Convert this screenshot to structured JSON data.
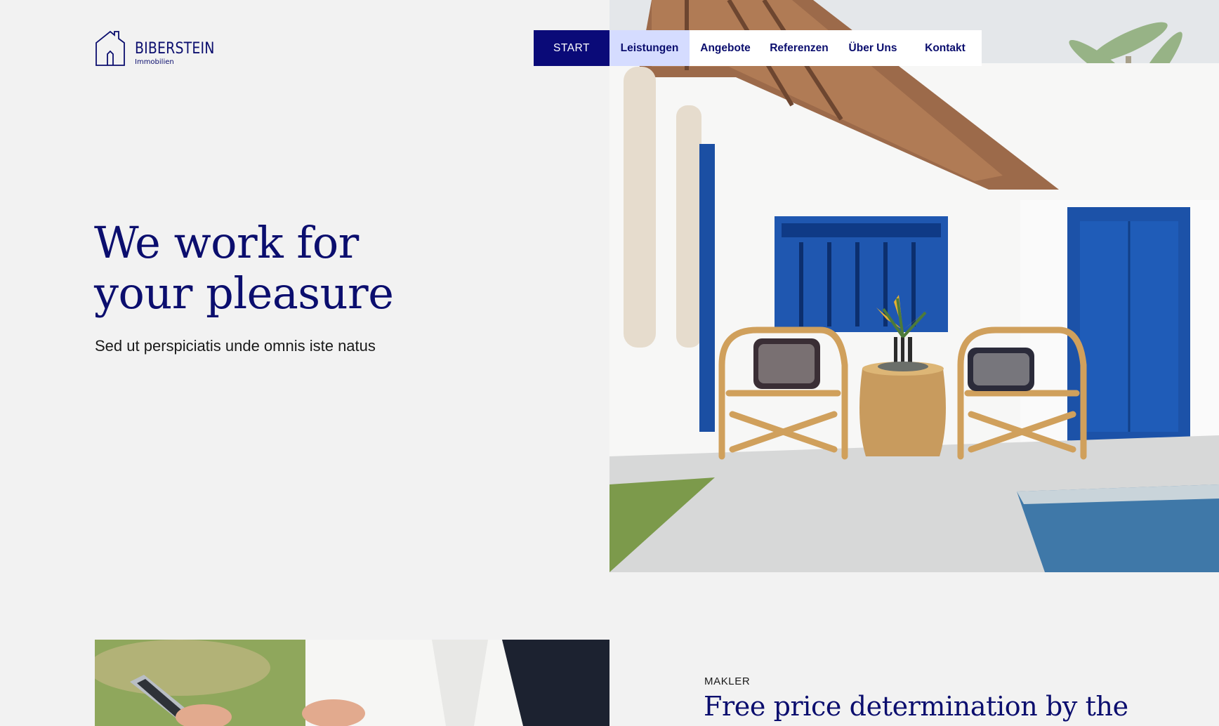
{
  "brand": {
    "name": "BIBERSTEIN",
    "subtitle": "Immobilien",
    "icon": "house-outline-icon"
  },
  "nav": {
    "items": [
      {
        "label": "START",
        "state": "active"
      },
      {
        "label": "Leistungen",
        "state": "hover"
      },
      {
        "label": "Angebote",
        "state": "default"
      },
      {
        "label": "Referenzen",
        "state": "default"
      },
      {
        "label": "Über Uns",
        "state": "default"
      },
      {
        "label": "Kontakt",
        "state": "default"
      }
    ]
  },
  "hero": {
    "title_line1": "We work for",
    "title_line2": "your pleasure",
    "subtitle": "Sed ut perspiciatis unde omnis iste natus",
    "image": "house-patio-with-blue-window-rattan-chairs-and-pool"
  },
  "section": {
    "eyebrow": "MAKLER",
    "title": "Free price determination by the",
    "image": "man-holding-tablet-outdoors"
  },
  "colors": {
    "primary": "#0b0e6e",
    "nav_active_bg": "#0a0a78",
    "nav_hover_bg": "#d5dcff",
    "page_bg": "#f2f2f2"
  }
}
